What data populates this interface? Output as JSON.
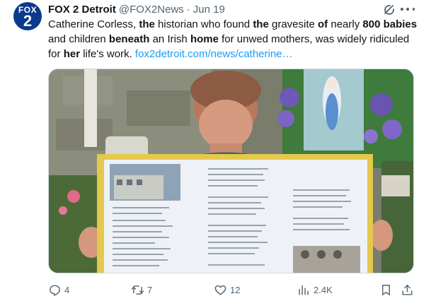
{
  "avatar": {
    "line1": "FOX",
    "line2": "2",
    "bg_color": "#0b3a8c"
  },
  "header": {
    "name": "FOX 2 Detroit",
    "handle": "@FOX2News",
    "separator": "·",
    "time": "Jun 19"
  },
  "tweet_text": {
    "p1": "Catherine Corless, ",
    "b1": "the",
    "p2": " historian who found ",
    "b2": "the",
    "p3": " gravesite ",
    "b3": "of",
    "p4": " nearly ",
    "b4": "800",
    "p5": " ",
    "b5": "babies",
    "p6": " and children ",
    "b6": "beneath",
    "p7": " an Irish ",
    "b7": "home",
    "p8": " for unwed mothers, was widely ridiculed for ",
    "b8": "her",
    "p9": " life's work. ",
    "link": "fox2detroit.com/news/catherine…"
  },
  "actions": {
    "replies": "4",
    "reposts": "7",
    "likes": "12",
    "views": "2.4K"
  },
  "colors": {
    "link": "#1d9bf0",
    "muted": "#536471",
    "text": "#0f1419"
  },
  "icons": [
    "grok-icon",
    "more-icon",
    "reply-icon",
    "repost-icon",
    "like-icon",
    "views-icon",
    "bookmark-icon",
    "share-icon"
  ]
}
